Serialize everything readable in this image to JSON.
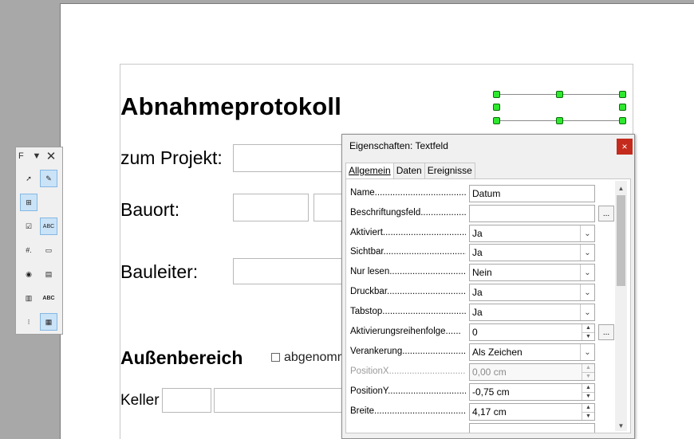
{
  "document": {
    "title": "Abnahmeprotokoll",
    "labels": {
      "project": "zum Projekt:",
      "site": "Bauort:",
      "manager": "Bauleiter:",
      "outdoor": "Außenbereich",
      "cellar": "Keller"
    },
    "checkbox_label": "abgenomm"
  },
  "toolbar": {
    "title": "F",
    "buttons": [
      {
        "name": "select-icon",
        "glyph": "➚"
      },
      {
        "name": "design-mode-icon",
        "glyph": "✎"
      },
      {
        "name": "control-wizards-icon",
        "glyph": "⊞"
      },
      {
        "name": "checkbox-icon",
        "glyph": "☑"
      },
      {
        "name": "text-box-icon",
        "glyph": "ABC"
      },
      {
        "name": "formatted-field-icon",
        "glyph": "#."
      },
      {
        "name": "push-button-icon",
        "glyph": "▭"
      },
      {
        "name": "option-button-icon",
        "glyph": "◉"
      },
      {
        "name": "list-box-icon",
        "glyph": "▤"
      },
      {
        "name": "combo-box-icon",
        "glyph": "▥"
      },
      {
        "name": "label-field-icon",
        "glyph": "ABC"
      },
      {
        "name": "more-controls-icon",
        "glyph": "⁝"
      },
      {
        "name": "form-design-icon",
        "glyph": "▦"
      }
    ]
  },
  "dialog": {
    "title": "Eigenschaften: Textfeld",
    "close_glyph": "×",
    "tabs": [
      "Allgemein",
      "Daten",
      "Ereignisse"
    ],
    "properties": [
      {
        "label": "Name......................................",
        "value": "Datum",
        "kind": "text"
      },
      {
        "label": "Beschriftungsfeld..................",
        "value": "",
        "kind": "button-field"
      },
      {
        "label": "Aktiviert.....................................",
        "value": "Ja",
        "kind": "dropdown"
      },
      {
        "label": "Sichtbar......................................",
        "value": "Ja",
        "kind": "dropdown"
      },
      {
        "label": "Nur lesen.................................",
        "value": "Nein",
        "kind": "dropdown"
      },
      {
        "label": "Druckbar.....................................",
        "value": "Ja",
        "kind": "dropdown"
      },
      {
        "label": "Tabstop......................................",
        "value": "Ja",
        "kind": "dropdown"
      },
      {
        "label": "Aktivierungsreihenfolge......",
        "value": "0",
        "kind": "spin-button"
      },
      {
        "label": "Verankerung.........................",
        "value": "Als Zeichen",
        "kind": "dropdown"
      },
      {
        "label": "PositionX..................................",
        "value": "0,00 cm",
        "kind": "spin-disabled"
      },
      {
        "label": "PositionY..................................",
        "value": "-0,75 cm",
        "kind": "spin"
      },
      {
        "label": "Breite.........................................",
        "value": "4,17 cm",
        "kind": "spin"
      },
      {
        "label": "",
        "value": "",
        "kind": "partial"
      }
    ],
    "ellipsis_label": "...",
    "dropdown_glyph": "⌄"
  },
  "colors": {
    "handle": "#2ee82e",
    "close_button": "#c42b1c",
    "tool_active": "#cbe3f7"
  }
}
